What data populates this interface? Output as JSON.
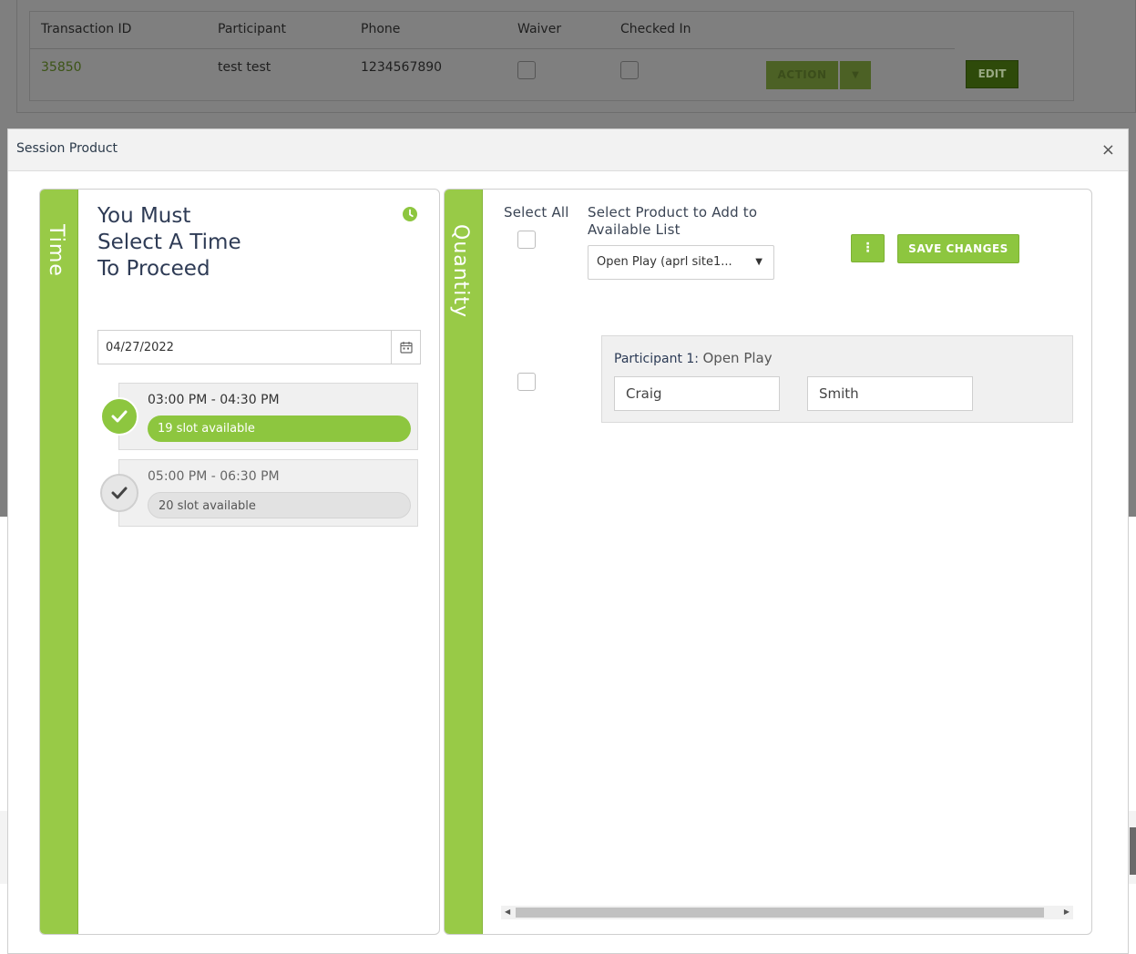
{
  "background": {
    "table": {
      "headers": [
        "Transaction ID",
        "Participant",
        "Phone",
        "Waiver",
        "Checked In"
      ],
      "row": {
        "transaction_id": "35850",
        "participant": "test test",
        "phone": "1234567890"
      },
      "action_label": "ACTION",
      "edit_label": "EDIT"
    }
  },
  "modal": {
    "title": "Session Product",
    "close_glyph": "×"
  },
  "time_panel": {
    "tab_label": "Time",
    "prompt": "You Must Select A Time To Proceed",
    "date_value": "04/27/2022",
    "slots": [
      {
        "time": "03:00 PM - 04:30 PM",
        "availability": "19 slot available",
        "selected": true
      },
      {
        "time": "05:00 PM - 06:30 PM",
        "availability": "20 slot available",
        "selected": false
      }
    ]
  },
  "quantity_panel": {
    "tab_label": "Quantity",
    "select_all_label": "Select All",
    "product_label": "Select Product to Add to Available List",
    "product_selected": "Open Play (aprl site1...",
    "kebab_glyph": "⋮",
    "save_label": "SAVE CHANGES",
    "participant": {
      "label": "Participant 1:",
      "product": "Open Play",
      "first_name": "Craig",
      "last_name": "Smith"
    }
  },
  "colors": {
    "accent_green": "#8dc63f",
    "tab_green": "#98ca47",
    "title_navy": "#2e3b55"
  }
}
